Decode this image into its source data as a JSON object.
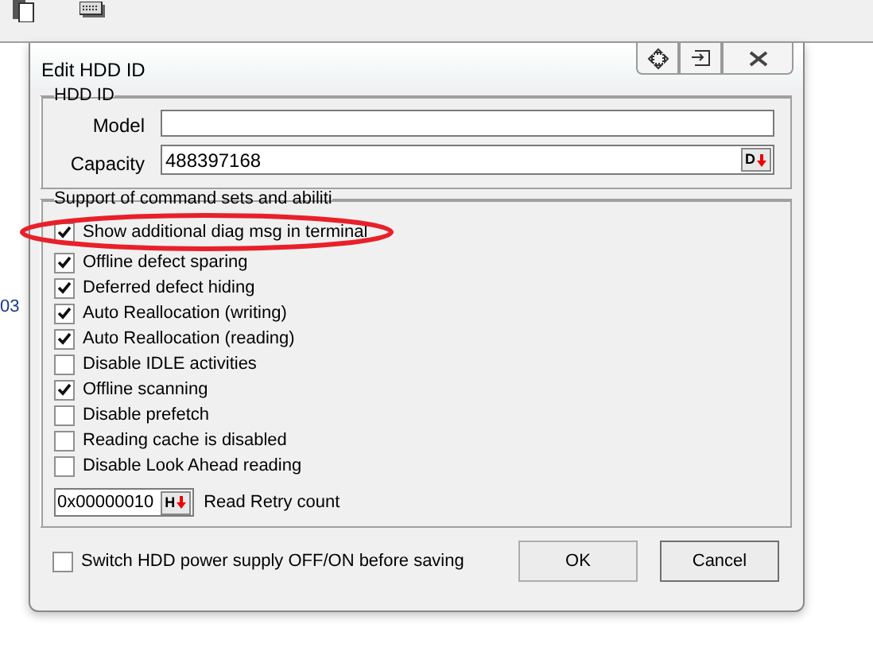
{
  "background_text": "03",
  "window": {
    "title": "Edit HDD ID"
  },
  "hdd_id": {
    "title": "HDD ID",
    "model": {
      "label": "Model"
    },
    "capacity": {
      "label": "Capacity",
      "value": "488397168",
      "button": "D"
    }
  },
  "support": {
    "title": "Support of command sets and abiliti",
    "options": [
      {
        "label": "Show additional diag msg in terminal",
        "checked": true
      },
      {
        "label": "Offline defect sparing",
        "checked": true
      },
      {
        "label": "Deferred defect hiding",
        "checked": true
      },
      {
        "label": "Auto Reallocation (writing)",
        "checked": true
      },
      {
        "label": "Auto Reallocation (reading)",
        "checked": true
      },
      {
        "label": "Disable IDLE activities",
        "checked": false
      },
      {
        "label": "Offline scanning",
        "checked": true
      },
      {
        "label": "Disable prefetch",
        "checked": false
      },
      {
        "label": "Reading cache is disabled",
        "checked": false
      },
      {
        "label": "Disable Look Ahead reading",
        "checked": false
      }
    ],
    "retry": {
      "value": "0x00000010",
      "button": "H",
      "label": "Read Retry count"
    }
  },
  "power_switch": {
    "label": "Switch HDD power supply OFF/ON before saving",
    "checked": false
  },
  "buttons": [
    "OK",
    "Cancel"
  ]
}
